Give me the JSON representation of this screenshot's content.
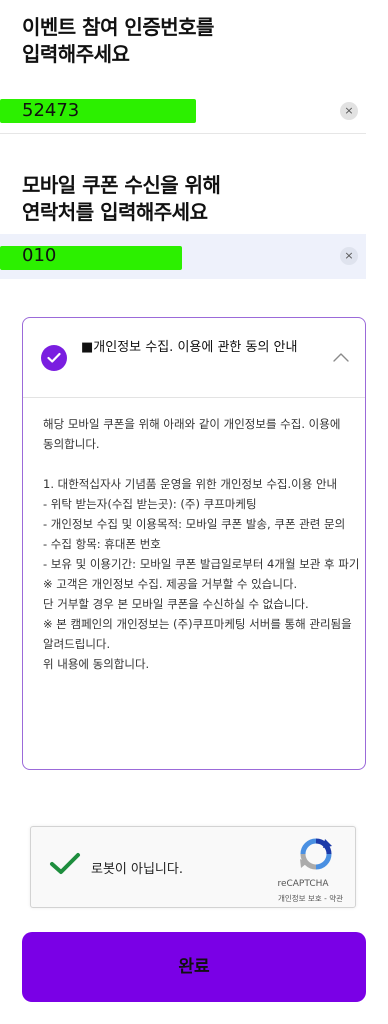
{
  "event_code": {
    "title_lines": [
      "이벤트 참여 인증번호를",
      "입력해주세요"
    ],
    "value": "52473",
    "clear_symbol": "×"
  },
  "phone": {
    "title_lines": [
      "모바일 쿠폰 수신을 위해",
      "연락처를 입력해주세요"
    ],
    "value": "010",
    "clear_symbol": "×"
  },
  "consent": {
    "title": "■개인정보 수집. 이용에 관한 동의 안내",
    "checked": true,
    "expanded": true,
    "body": [
      "해당 모바일 쿠폰을 위해 아래와 같이 개인정보를 수집. 이용에 동의합니다.",
      "",
      "1. 대한적십자사 기념품 운영을 위한 개인정보 수집.이용 안내",
      "- 위탁 받는자(수집 받는곳): (주) 쿠프마케팅",
      "- 개인정보 수집 및 이용목적: 모바일 쿠폰 발송, 쿠폰 관련 문의",
      "- 수집 항목: 휴대폰 번호",
      "- 보유 및 이용기간: 모바일 쿠폰 발급일로부터 4개월 보관 후 파기",
      "※ 고객은 개인정보 수집. 제공을 거부할 수 있습니다.",
      "단 거부할 경우 본 모바일 쿠폰을 수신하실 수 없습니다.",
      "※ 본 캠페인의 개인정보는 (주)쿠프마케팅 서버를 통해 관리됨을 알려드립니다.",
      "위 내용에 동의합니다."
    ]
  },
  "captcha": {
    "label": "로봇이 아닙니다.",
    "brand": "reCAPTCHA",
    "links": "개인정보 보호 - 약관",
    "checked": true
  },
  "submit": {
    "label": "완료"
  },
  "colors": {
    "accent": "#7a00e6",
    "highlight": "#2cf000",
    "check_green": "#1e8e3e"
  }
}
